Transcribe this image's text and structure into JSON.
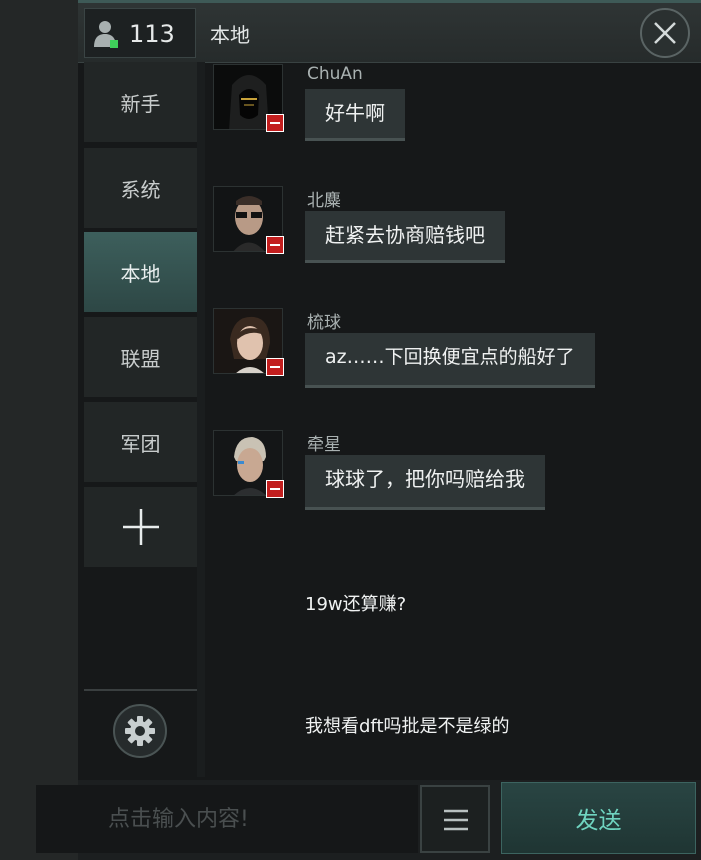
{
  "header": {
    "online_count": "113",
    "channel_title": "本地"
  },
  "sidebar": {
    "items": [
      {
        "label": "新手"
      },
      {
        "label": "系统"
      },
      {
        "label": "本地"
      },
      {
        "label": "联盟"
      },
      {
        "label": "军团"
      }
    ],
    "active_index": 2
  },
  "messages": [
    {
      "sender": "ChuAn",
      "text": "好牛啊"
    },
    {
      "sender": "北麋",
      "text": "赶紧去协商赔钱吧"
    },
    {
      "sender": "梳球",
      "text": "az……下回换便宜点的船好了"
    },
    {
      "sender": "牵星",
      "text": "球球了，把你吗赔给我"
    },
    {
      "sender": "",
      "text": "19w还算赚?"
    },
    {
      "sender": "",
      "text": "我想看dft吗批是不是绿的"
    }
  ],
  "input": {
    "placeholder": "点击输入内容!",
    "value": ""
  },
  "send_label": "发送",
  "colors": {
    "accent": "#6fd4c0",
    "active_tab": "#3d5f5c",
    "badge_red": "#c21e1e",
    "online_green": "#3fcf5a"
  },
  "icons": {
    "user": "user-icon",
    "close": "close-icon",
    "add": "plus-icon",
    "settings": "gear-icon",
    "menu": "menu-icon",
    "badge": "minus-badge-icon"
  }
}
